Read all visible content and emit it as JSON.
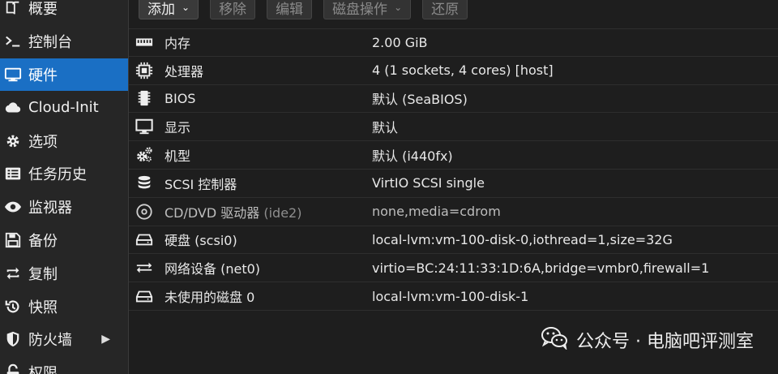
{
  "sidebar": {
    "items": [
      {
        "label": "概要",
        "icon": "book-icon",
        "active": false
      },
      {
        "label": "控制台",
        "icon": "terminal-icon",
        "active": false
      },
      {
        "label": "硬件",
        "icon": "monitor-icon",
        "active": true
      },
      {
        "label": "Cloud-Init",
        "icon": "cloud-icon",
        "active": false
      },
      {
        "label": "选项",
        "icon": "gear-icon",
        "active": false
      },
      {
        "label": "任务历史",
        "icon": "list-icon",
        "active": false
      },
      {
        "label": "监视器",
        "icon": "eye-icon",
        "active": false
      },
      {
        "label": "备份",
        "icon": "floppy-icon",
        "active": false
      },
      {
        "label": "复制",
        "icon": "retweet-icon",
        "active": false
      },
      {
        "label": "快照",
        "icon": "history-icon",
        "active": false
      },
      {
        "label": "防火墙",
        "icon": "shield-icon",
        "active": false,
        "has_arrow": true
      },
      {
        "label": "权限",
        "icon": "unlock-icon",
        "active": false
      }
    ],
    "arrow": "▶"
  },
  "toolbar": {
    "add": "添加",
    "remove": "移除",
    "edit": "编辑",
    "disk_action": "磁盘操作",
    "revert": "还原",
    "caret": "⌄"
  },
  "hardware": [
    {
      "name": "内存",
      "sub": "",
      "value": "2.00 GiB",
      "icon": "memory-icon"
    },
    {
      "name": "处理器",
      "sub": "",
      "value": "4 (1 sockets, 4 cores) [host]",
      "icon": "cpu-icon"
    },
    {
      "name": "BIOS",
      "sub": "",
      "value": "默认 (SeaBIOS)",
      "icon": "microchip-icon"
    },
    {
      "name": "显示",
      "sub": "",
      "value": "默认",
      "icon": "desktop-icon"
    },
    {
      "name": "机型",
      "sub": "",
      "value": "默认 (i440fx)",
      "icon": "cogs-icon"
    },
    {
      "name": "SCSI 控制器",
      "sub": "",
      "value": "VirtIO SCSI single",
      "icon": "database-icon"
    },
    {
      "name": "CD/DVD 驱动器",
      "sub": " (ide2)",
      "value": "none,media=cdrom",
      "icon": "cdrom-icon",
      "muted": true
    },
    {
      "name": "硬盘",
      "sub": " (scsi0)",
      "value": "local-lvm:vm-100-disk-0,iothread=1,size=32G",
      "icon": "hdd-icon"
    },
    {
      "name": "网络设备",
      "sub": " (net0)",
      "value": "virtio=BC:24:11:33:1D:6A,bridge=vmbr0,firewall=1",
      "icon": "exchange-icon"
    },
    {
      "name": "未使用的磁盘 0",
      "sub": "",
      "value": "local-lvm:vm-100-disk-1",
      "icon": "hdd-icon"
    }
  ],
  "watermark": {
    "text": "公众号 · 电脑吧评测室",
    "icon": "wechat-icon"
  }
}
